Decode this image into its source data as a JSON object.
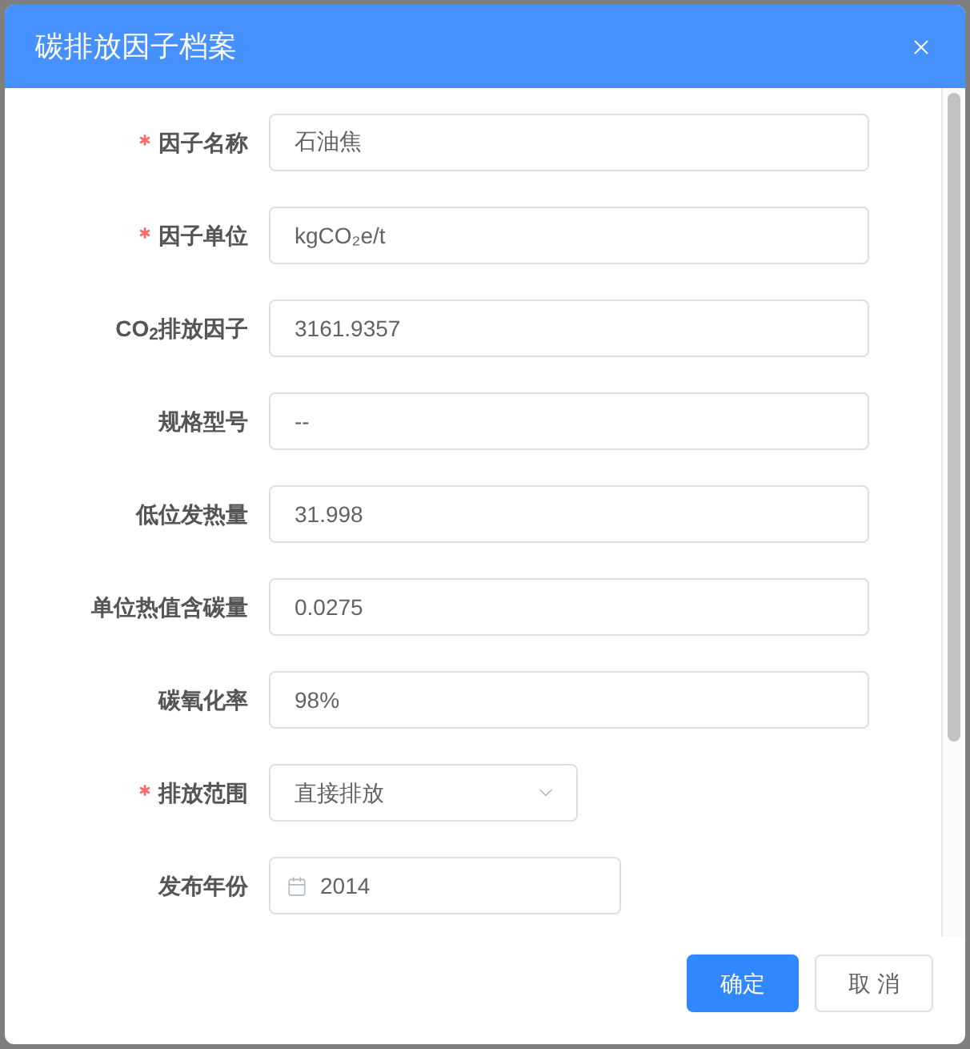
{
  "dialog": {
    "title": "碳排放因子档案",
    "fields": [
      {
        "label": "因子名称",
        "required": true,
        "kind": "text",
        "value": "石油焦"
      },
      {
        "label": "因子单位",
        "required": true,
        "kind": "text",
        "value": "kgCO₂e/t"
      },
      {
        "label": "CO$_{2}$排放因子",
        "required": false,
        "kind": "text",
        "value": "3161.9357"
      },
      {
        "label": "规格型号",
        "required": false,
        "kind": "text",
        "value": "--"
      },
      {
        "label": "低位发热量",
        "required": false,
        "kind": "text",
        "value": "31.998"
      },
      {
        "label": "单位热值含碳量",
        "required": false,
        "kind": "text",
        "value": "0.0275"
      },
      {
        "label": "碳氧化率",
        "required": false,
        "kind": "text",
        "value": "98%"
      },
      {
        "label": "排放范围",
        "required": true,
        "kind": "select",
        "value": "直接排放"
      },
      {
        "label": "发布年份",
        "required": false,
        "kind": "date",
        "value": "2014"
      }
    ],
    "buttons": [
      {
        "label": "确定",
        "kind": "primary"
      },
      {
        "label": "取 消",
        "kind": "default"
      }
    ]
  }
}
